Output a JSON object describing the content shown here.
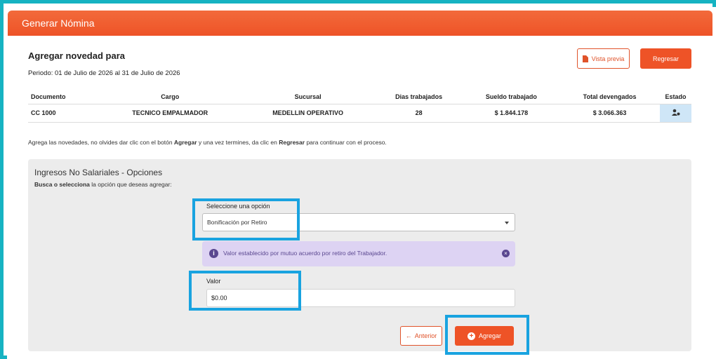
{
  "header": {
    "title": "Generar Nómina"
  },
  "main": {
    "title": "Agregar novedad para",
    "period": "Periodo: 01 de Julio de 2026 al 31 de Julio de 2026",
    "preview_button": "Vista previa",
    "back_button": "Regresar"
  },
  "table": {
    "headers": [
      "Documento",
      "Cargo",
      "Sucursal",
      "Dias trabajados",
      "Sueldo trabajado",
      "Total devengados",
      "Estado"
    ],
    "rows": [
      {
        "documento": "CC 1000",
        "cargo": "TECNICO EMPALMADOR",
        "sucursal": "MEDELLIN OPERATIVO",
        "dias": "28",
        "sueldo": "$ 1.844.178",
        "total": "$ 3.066.363"
      }
    ]
  },
  "note": {
    "part1": "Agrega las novedades, no olvides dar clic con el botón ",
    "bold1": "Agregar",
    "part2": " y una vez termines, da clic en ",
    "bold2": "Regresar",
    "part3": " para continuar con el proceso."
  },
  "panel": {
    "title": "Ingresos No Salariales - Opciones",
    "sub_bold": "Busca o selecciona",
    "sub_rest": " la opción que deseas agregar:",
    "select_label": "Seleccione una opción",
    "select_value": "Bonificación por Retiro",
    "alert_text": "Valor establecido por mutuo acuerdo por retiro del Trabajador.",
    "value_label": "Valor",
    "value_input": "$0.00",
    "prev_button": "Anterior",
    "add_button": "Agregar"
  },
  "colors": {
    "accent": "#ee5327",
    "highlight": "#19a3e0",
    "info_bg": "#ddd3f3"
  }
}
